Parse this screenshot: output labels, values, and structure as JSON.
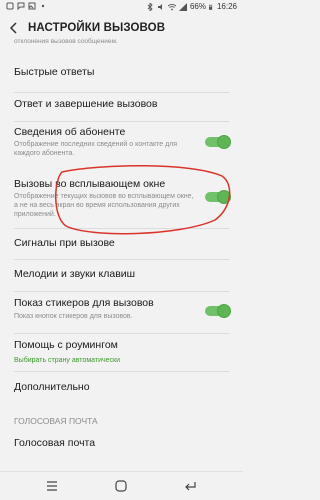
{
  "status": {
    "battery": "66%",
    "time": "16:26"
  },
  "header": {
    "title": "НАСТРОЙКИ ВЫЗОВОВ"
  },
  "cut_text": "отклонения вызовов сообщением.",
  "items": [
    {
      "label": "Быстрые ответы"
    },
    {
      "label": "Ответ и завершение вызовов"
    },
    {
      "label": "Сведения об абоненте",
      "sub": "Отображение последних сведений о контакте для каждого абонента.",
      "toggle": true
    },
    {
      "label": "Вызовы во всплывающем окне",
      "sub": "Отображение текущих вызовов во всплывающем окне, а не на весь экран во время использования других приложений.",
      "toggle": true
    },
    {
      "label": "Сигналы при вызове"
    },
    {
      "label": "Мелодии и звуки клавиш"
    },
    {
      "label": "Показ стикеров для вызовов",
      "sub": "Показ кнопок стикеров для вызовов.",
      "toggle": true
    },
    {
      "label": "Помощь с роумингом",
      "sub": "Выбирать страну автоматически"
    },
    {
      "label": "Дополнительно"
    },
    {
      "label": "Голосовая почта"
    }
  ],
  "section": {
    "voicemail_header": "ГОЛОСОВАЯ ПОЧТА"
  },
  "colors": {
    "toggle_on": "#5fb556",
    "annotation": "#d9342b",
    "sub_green": "#3a9a2a"
  }
}
